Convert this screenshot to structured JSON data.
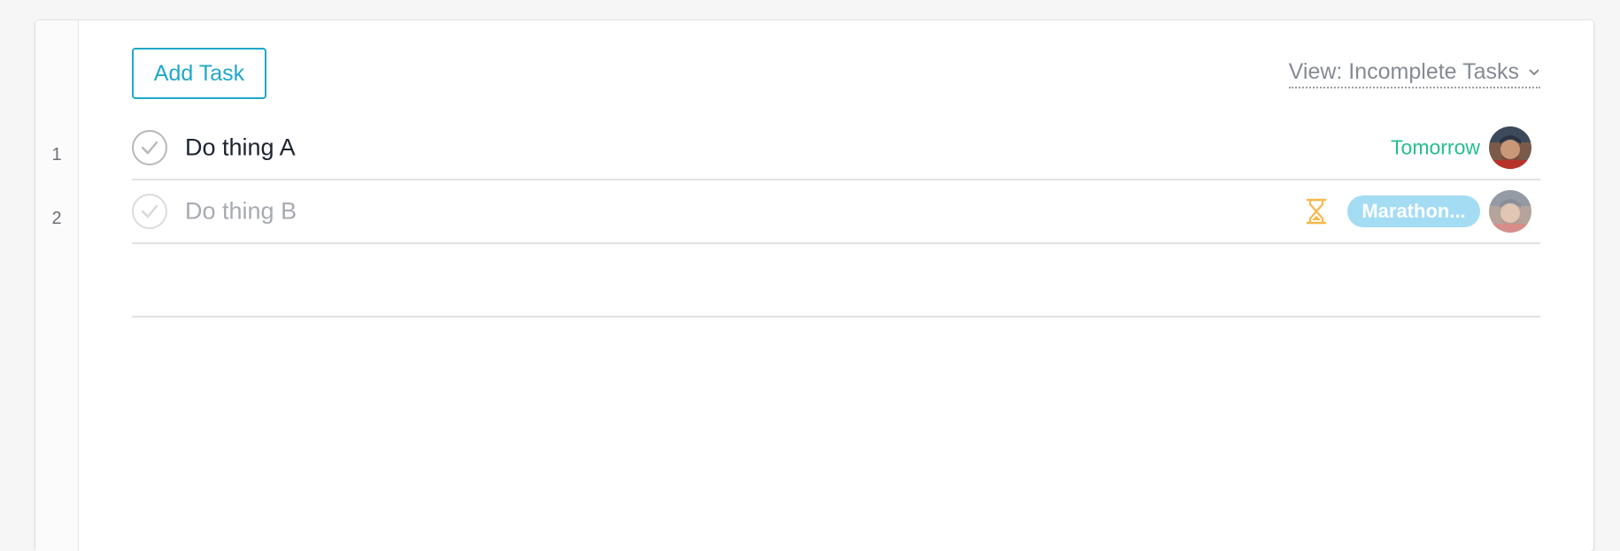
{
  "toolbar": {
    "add_task_label": "Add Task",
    "view_filter_label": "View: Incomplete Tasks"
  },
  "tasks": [
    {
      "line_number": "1",
      "name": "Do thing A",
      "due": "Tomorrow",
      "completed": false,
      "avatar_icon": "user-avatar"
    },
    {
      "line_number": "2",
      "name": "Do thing B",
      "tag": "Marathon...",
      "completed": true,
      "waiting_icon": "hourglass-icon",
      "avatar_icon": "user-avatar"
    }
  ],
  "colors": {
    "accent": "#1fa8c9",
    "due_green": "#25c089",
    "tag_blue": "#a3dcf3",
    "hourglass_orange": "#f7b84b"
  }
}
